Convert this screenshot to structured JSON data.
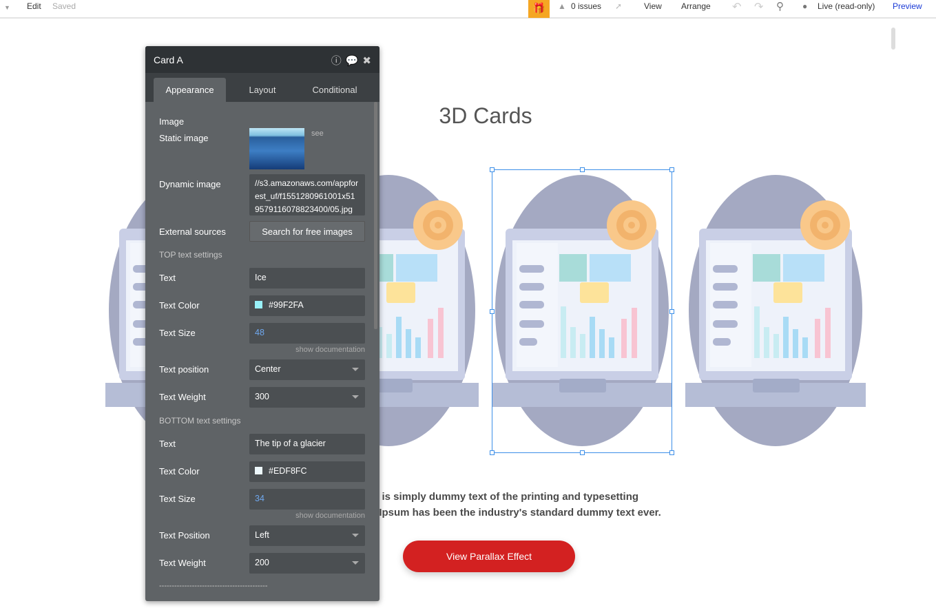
{
  "topbar": {
    "edit": "Edit",
    "saved": "Saved",
    "issues": "0 issues",
    "view": "View",
    "arrange": "Arrange",
    "live": "Live (read-only)",
    "preview": "Preview"
  },
  "canvas": {
    "title": "3D Cards",
    "paragraph_lines": [
      "m is simply dummy text of the printing and typesetting",
      "n Ipsum has been the industry's standard dummy text ever."
    ],
    "button": "View Parallax Effect",
    "button_color": "#D32121"
  },
  "panel": {
    "title": "Card A",
    "tabs": [
      {
        "label": "Appearance",
        "active": true
      },
      {
        "label": "Layout"
      },
      {
        "label": "Conditional"
      }
    ],
    "image_section": "Image",
    "static_image_label": "Static image",
    "see": "see",
    "dynamic_image_label": "Dynamic image",
    "dynamic_image_value": "//s3.amazonaws.com/appforest_uf/f1551280961001x519579116078823400/05.jpg",
    "external_sources_label": "External sources",
    "search_free_images": "Search for free images",
    "top": {
      "section": "TOP text settings",
      "text_label": "Text",
      "text": "Ice",
      "color_label": "Text Color",
      "color": "#99F2FA",
      "size_label": "Text Size",
      "size": "48",
      "show_doc": "show documentation",
      "position_label": "Text position",
      "position": "Center",
      "weight_label": "Text Weight",
      "weight": "300"
    },
    "bottom": {
      "section": "BOTTOM text settings",
      "text_label": "Text",
      "text": "The tip of a glacier",
      "color_label": "Text Color",
      "color": "#EDF8FC",
      "size_label": "Text Size",
      "size": "34",
      "show_doc": "show documentation",
      "position_label": "Text Position",
      "position": "Left",
      "weight_label": "Text Weight",
      "weight": "200"
    },
    "divider": "-------------------------------------------"
  }
}
